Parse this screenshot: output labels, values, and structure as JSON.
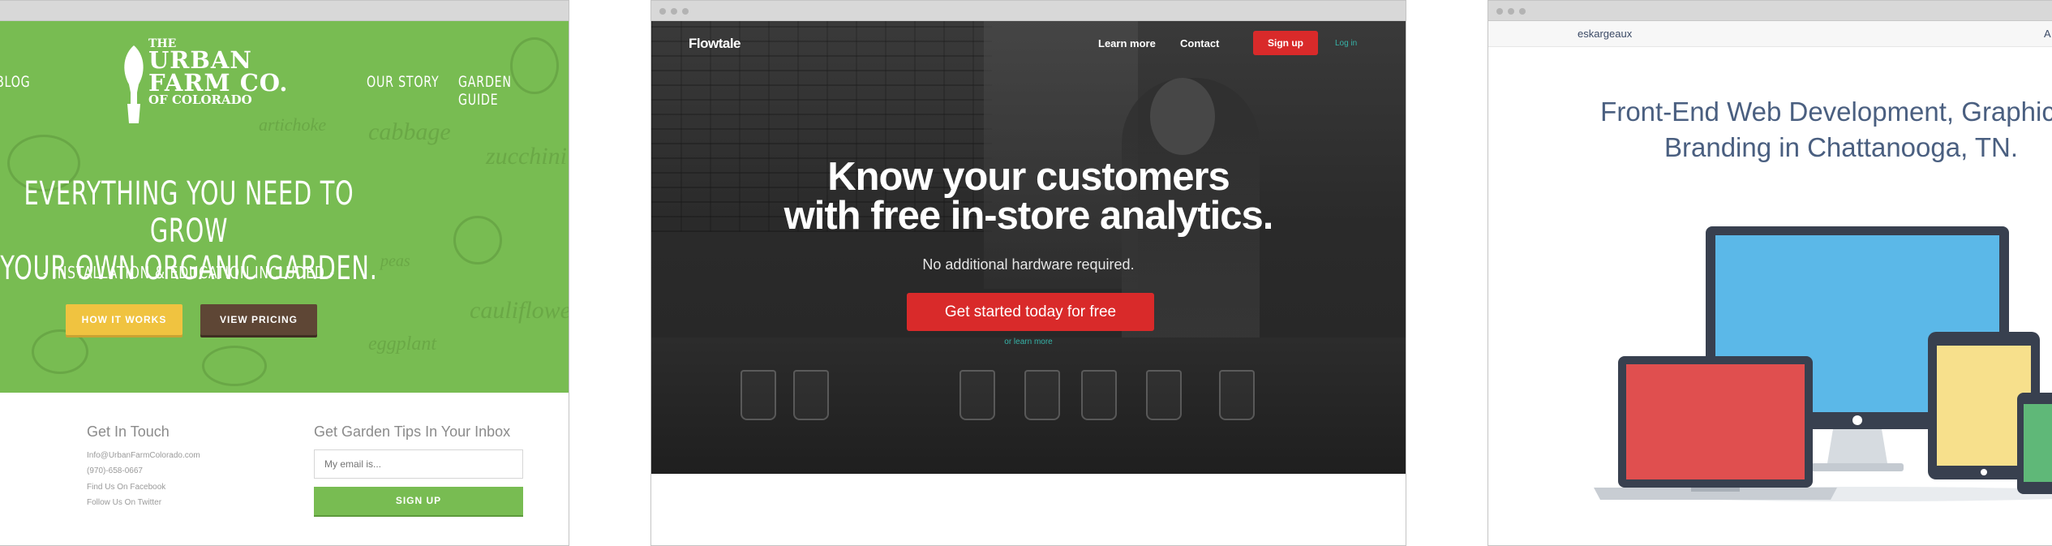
{
  "browser_1": {
    "nav": {
      "blog": "BLOG",
      "our_story": "OUR STORY",
      "garden_guide": "GARDEN GUIDE"
    },
    "logo": {
      "the": "THE",
      "line1": "URBAN",
      "line2": "FARM CO.",
      "line3": "OF COLORADO"
    },
    "hero": {
      "headline_1": "EVERYTHING YOU NEED TO GROW",
      "headline_2": "YOUR OWN ORGANIC GARDEN.",
      "subheadline": "- INSTALLATION & EDUCATION INCLUDED -",
      "how_it_works": "HOW IT WORKS",
      "view_pricing": "VIEW PRICING"
    },
    "doodles": [
      "cabbage",
      "zucchini",
      "artichoke",
      "cauliflower",
      "eggplant",
      "peas"
    ],
    "contact": {
      "title": "Get In Touch",
      "lines": [
        "Info@UrbanFarmColorado.com",
        "(970)-658-0667",
        "Find Us On Facebook",
        "Follow Us On Twitter"
      ]
    },
    "newsletter": {
      "title": "Get Garden Tips In Your Inbox",
      "placeholder": "My email is...",
      "button": "SIGN UP"
    },
    "colors": {
      "hero_green": "#78bc52",
      "yellow": "#f0c340",
      "brown": "#5e4635"
    }
  },
  "browser_2": {
    "logo": "Flowtale",
    "nav": {
      "learn_more": "Learn more",
      "contact": "Contact",
      "sign_up": "Sign up",
      "log_in": "Log in"
    },
    "hero": {
      "headline_1": "Know your customers",
      "headline_2": "with free in-store analytics.",
      "subheadline": "No additional hardware required.",
      "cta": "Get started today for free",
      "secondary": "or learn more"
    },
    "colors": {
      "accent_red": "#d92a2a",
      "link_teal": "#36b3a8"
    }
  },
  "browser_3": {
    "brand": "eskargeaux",
    "nav_partial": "A",
    "headline_1": "Front-End Web Development, Graphic D",
    "headline_2": "Branding in Chattanooga, TN.",
    "colors": {
      "heading_blue": "#4a5f80",
      "screen_blue": "#5bb8e8",
      "laptop_red": "#e04f4f",
      "tablet_yellow": "#f7e08c",
      "phone_green": "#5fb878",
      "device_frame": "#38404f"
    }
  }
}
